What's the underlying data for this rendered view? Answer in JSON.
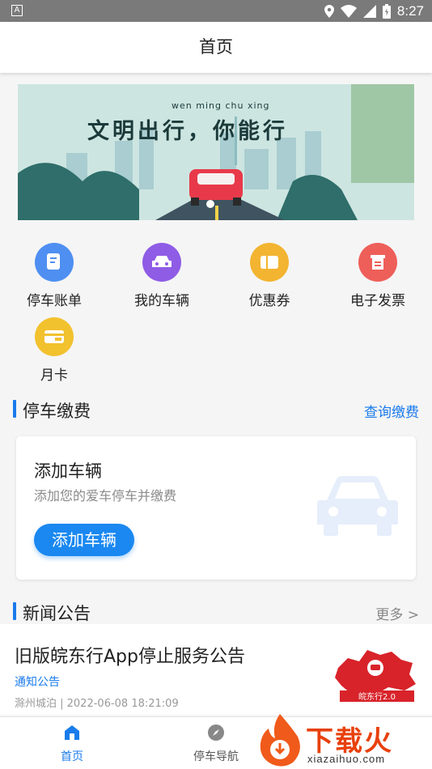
{
  "status_bar": {
    "time": "8:27",
    "left_badge": "A"
  },
  "header": {
    "title": "首页"
  },
  "banner": {
    "slogan": "文明出行，你能行",
    "slogan_pinyin": "wen ming chu xing"
  },
  "menu": [
    {
      "label": "停车账单",
      "icon": "bill-icon",
      "color": "#4f8ff2"
    },
    {
      "label": "我的车辆",
      "icon": "car-icon",
      "color": "#8f5ce6"
    },
    {
      "label": "优惠券",
      "icon": "coupon-icon",
      "color": "#f2b431"
    },
    {
      "label": "电子发票",
      "icon": "invoice-icon",
      "color": "#ee5f5a"
    },
    {
      "label": "月卡",
      "icon": "vip-card-icon",
      "color": "#f2c12e"
    }
  ],
  "parking_section": {
    "title": "停车缴费",
    "link": "查询缴费"
  },
  "add_vehicle_card": {
    "title": "添加车辆",
    "subtitle": "添加您的爱车停车并缴费",
    "button": "添加车辆"
  },
  "news_section": {
    "title": "新闻公告",
    "more": "更多 >"
  },
  "news_item": {
    "title": "旧版皖东行App停止服务公告",
    "tag": "通知公告",
    "meta": "滁州城泊 | 2022-06-08 18:21:09",
    "thumb_caption": "皖东行2.0"
  },
  "bottom_nav": [
    {
      "label": "首页",
      "icon": "home-icon",
      "active": true
    },
    {
      "label": "停车导航",
      "icon": "compass-icon",
      "active": false
    }
  ],
  "watermark": {
    "text": "下载火",
    "url": "xiazaihuo.com"
  },
  "colors": {
    "accent": "#1a7bec",
    "watermark": "#e8400c"
  }
}
